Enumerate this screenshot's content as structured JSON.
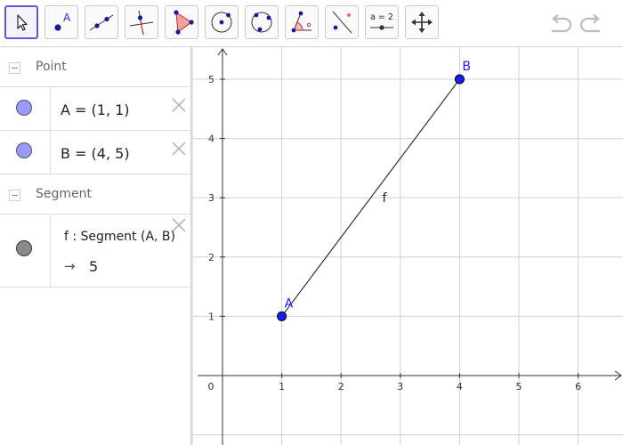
{
  "toolbar": {
    "tools": [
      {
        "name": "move-tool",
        "selected": true
      },
      {
        "name": "point-tool",
        "label": "A"
      },
      {
        "name": "line-tool"
      },
      {
        "name": "perpendicular-line-tool"
      },
      {
        "name": "polygon-tool"
      },
      {
        "name": "circle-center-point-tool"
      },
      {
        "name": "circle-three-points-tool"
      },
      {
        "name": "angle-tool"
      },
      {
        "name": "reflect-about-line-tool"
      },
      {
        "name": "slider-tool",
        "label": "a = 2"
      },
      {
        "name": "move-graphics-view-tool"
      }
    ],
    "undo": "undo",
    "redo": "redo"
  },
  "algebra": {
    "groups": [
      {
        "label": "Point"
      },
      {
        "label": "Segment"
      }
    ],
    "items": [
      {
        "text": "A = (1, 1)",
        "color": "#9999ff"
      },
      {
        "text": "B = (4, 5)",
        "color": "#9999ff"
      },
      {
        "definition": "f : Segment (A, B)",
        "value": "5",
        "arrow": "→",
        "color": "#8a8a8a"
      }
    ]
  },
  "graphics": {
    "x_ticks": [
      "0",
      "1",
      "2",
      "3",
      "4",
      "5",
      "6"
    ],
    "y_ticks": [
      "1",
      "2",
      "3",
      "4",
      "5"
    ],
    "points": [
      {
        "label": "A",
        "x": 1,
        "y": 1
      },
      {
        "label": "B",
        "x": 4,
        "y": 5
      }
    ],
    "segment_label": "f",
    "point_color": "#1a1aff",
    "grid_color": "#d0d0d0"
  }
}
